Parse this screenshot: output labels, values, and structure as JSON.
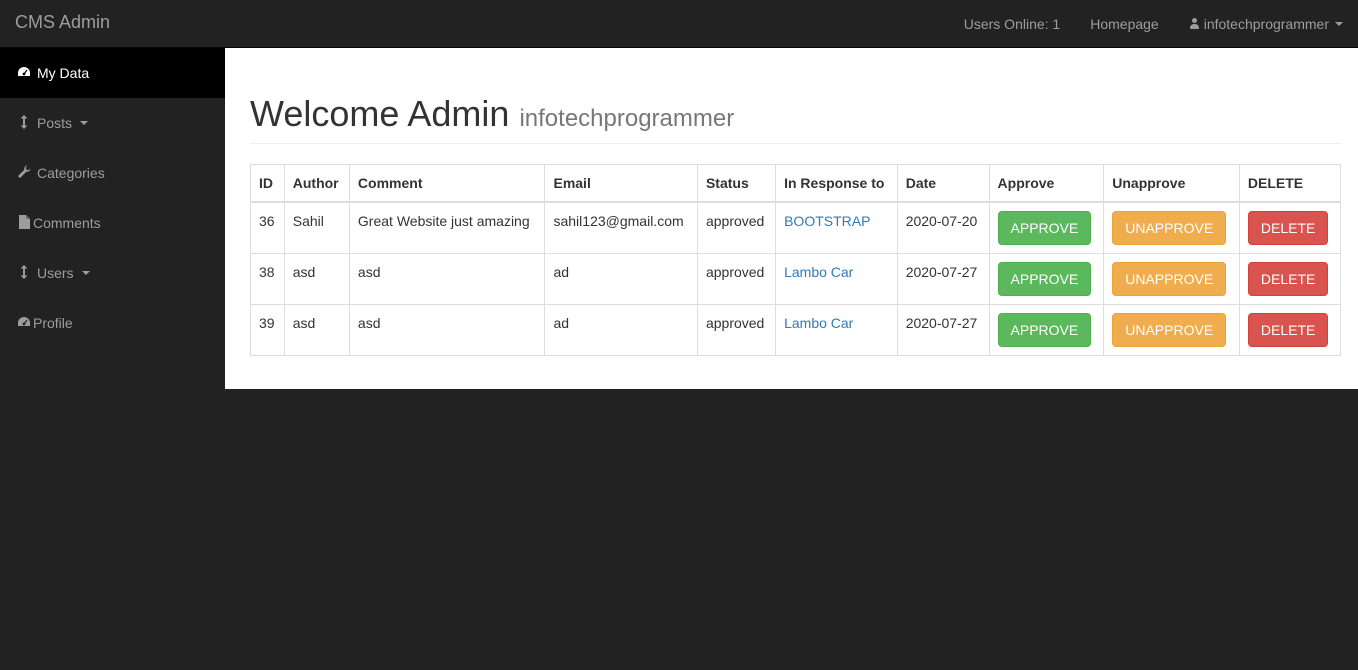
{
  "navbar": {
    "brand": "CMS Admin",
    "users_online": "Users Online: 1",
    "homepage": "Homepage",
    "username": "infotechprogrammer"
  },
  "sidebar": {
    "items": [
      {
        "label": "My Data",
        "icon": "dashboard-icon"
      },
      {
        "label": "Posts",
        "icon": "arrows-v-icon"
      },
      {
        "label": "Categories",
        "icon": "wrench-icon"
      },
      {
        "label": "Comments",
        "icon": "file-icon"
      },
      {
        "label": "Users",
        "icon": "arrows-v-icon"
      },
      {
        "label": "Profile",
        "icon": "dashboard-icon"
      }
    ]
  },
  "main": {
    "title": "Welcome Admin",
    "subtitle": "infotechprogrammer",
    "table": {
      "headers": [
        "ID",
        "Author",
        "Comment",
        "Email",
        "Status",
        "In Response to",
        "Date",
        "Approve",
        "Unapprove",
        "DELETE"
      ],
      "rows": [
        {
          "id": "36",
          "author": "Sahil",
          "comment": "Great Website just amazing",
          "email": "sahil123@gmail.com",
          "status": "approved",
          "response": "BOOTSTRAP",
          "date": "2020-07-20",
          "approve": "APPROVE",
          "unapprove": "UNAPPROVE",
          "delete": "DELETE"
        },
        {
          "id": "38",
          "author": "asd",
          "comment": "asd",
          "email": "ad",
          "status": "approved",
          "response": "Lambo Car",
          "date": "2020-07-27",
          "approve": "APPROVE",
          "unapprove": "UNAPPROVE",
          "delete": "DELETE"
        },
        {
          "id": "39",
          "author": "asd",
          "comment": "asd",
          "email": "ad",
          "status": "approved",
          "response": "Lambo Car",
          "date": "2020-07-27",
          "approve": "APPROVE",
          "unapprove": "UNAPPROVE",
          "delete": "DELETE"
        }
      ]
    }
  },
  "colors": {
    "navbar_bg": "#222222",
    "active_item_bg": "#000000",
    "link": "#337ab7",
    "approve": "#5cb85c",
    "unapprove": "#f0ad4e",
    "delete": "#d9534f"
  }
}
